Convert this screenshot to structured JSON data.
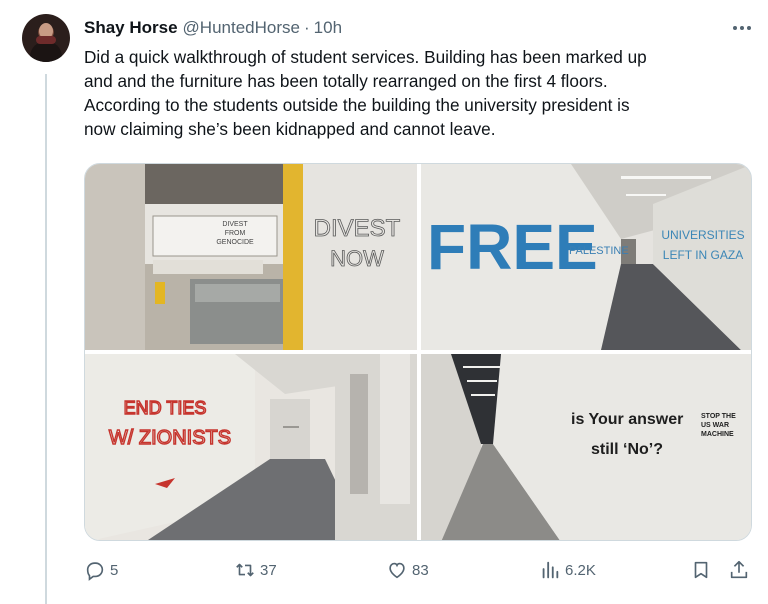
{
  "tweet": {
    "author_name": "Shay Horse",
    "author_handle": "@HuntedHorse",
    "separator": "·",
    "time": "10h",
    "text_lines": [
      "Did a quick walkthrough of student services. Building has been marked up",
      "and and the furniture has been totally rearranged on the first 4 floors.",
      "According to the students outside the building the university president is",
      "now claiming she’s been kidnapped and cannot leave."
    ]
  },
  "media": {
    "photo1": {
      "graffiti_main": [
        "DIVEST",
        "NOW"
      ],
      "graffiti_small": [
        "DIVEST",
        "FROM",
        "GENOCIDE"
      ]
    },
    "photo2": {
      "graffiti_main": "FREE",
      "graffiti_small": "PALESTINE",
      "graffiti_right": [
        "UNIVERSITIES",
        "LEFT IN GAZA"
      ]
    },
    "photo3": {
      "graffiti": [
        "END TIES",
        "W/ ZIONISTS"
      ]
    },
    "photo4": {
      "graffiti_main": [
        "is Your answer",
        "still ‘No’?"
      ],
      "graffiti_stencil": [
        "STOP THE",
        "US WAR",
        "MACHINE"
      ]
    }
  },
  "actions": {
    "replies": "5",
    "retweets": "37",
    "likes": "83",
    "views": "6.2K"
  },
  "icons": [
    "more-icon",
    "reply-icon",
    "retweet-icon",
    "like-icon",
    "views-icon",
    "bookmark-icon",
    "share-icon"
  ],
  "colors": {
    "text": "#0f1419",
    "secondary": "#536471",
    "border": "#cfd9de"
  }
}
